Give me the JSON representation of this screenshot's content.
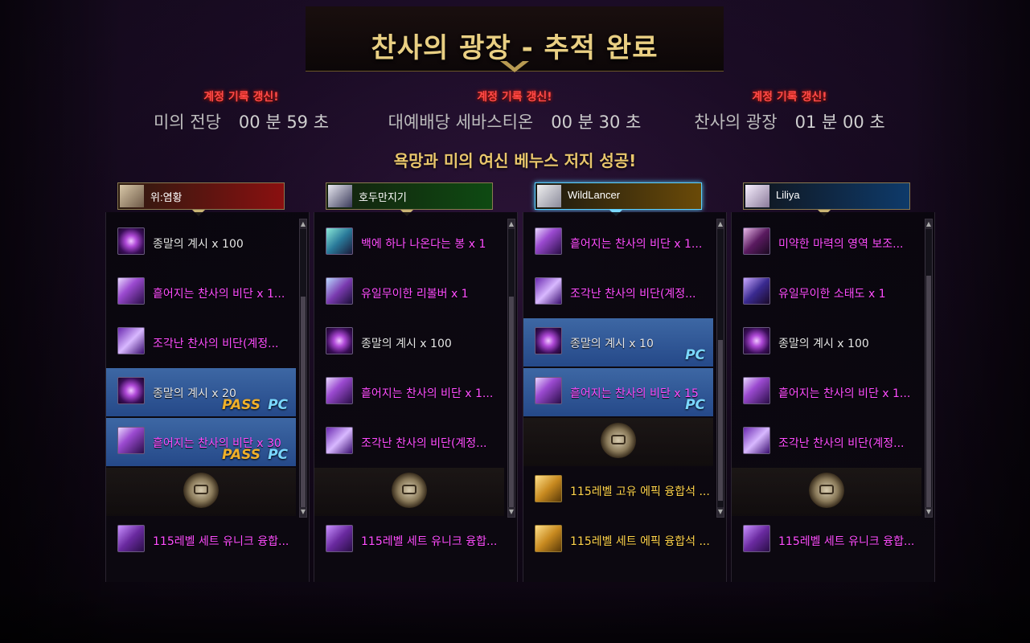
{
  "title": "찬사의 광장 - 추적 완료",
  "records": [
    {
      "badge": "계정 기록 갱신!",
      "dungeon": "미의 전당",
      "time": "00 분 59 초"
    },
    {
      "badge": "계정 기록 갱신!",
      "dungeon": "대예배당 세바스티온",
      "time": "00 분 30 초"
    },
    {
      "badge": "계정 기록 갱신!",
      "dungeon": "찬사의 광장",
      "time": "01 분 00 초"
    }
  ],
  "success_message": "욕망과 미의 여신 베누스 저지 성공!",
  "players": [
    {
      "name": "위:염황",
      "nameplate_color": "#8a1010",
      "items": [
        {
          "icon": "orb",
          "label": "종말의 계시 x 100",
          "color": "white"
        },
        {
          "icon": "wing",
          "label": "흩어지는 찬사의 비단 x 1...",
          "color": "magenta"
        },
        {
          "icon": "shard",
          "label": "조각난 찬사의 비단(계정...",
          "color": "magenta"
        },
        {
          "icon": "orb",
          "label": "종말의 계시 x 20",
          "color": "white",
          "pass": "PASS",
          "pc": "PC",
          "highlight": true
        },
        {
          "icon": "wing",
          "label": "흩어지는 찬사의 비단 x 30",
          "color": "magenta",
          "pass": "PASS",
          "pc": "PC",
          "highlight": true
        }
      ],
      "bonus": {
        "icon": "set",
        "label": "115레벨 세트 유니크 융합...",
        "color": "magenta"
      }
    },
    {
      "name": "호두만지기",
      "nameplate_color": "#0e4a12",
      "items": [
        {
          "icon": "teal",
          "label": "백에 하나 나온다는 봉 x 1",
          "color": "magenta"
        },
        {
          "icon": "rev",
          "label": "유일무이한 리볼버 x 1",
          "color": "magenta"
        },
        {
          "icon": "orb",
          "label": "종말의 계시 x 100",
          "color": "white"
        },
        {
          "icon": "wing",
          "label": "흩어지는 찬사의 비단 x 1...",
          "color": "magenta"
        },
        {
          "icon": "shard",
          "label": "조각난 찬사의 비단(계정...",
          "color": "magenta"
        }
      ],
      "bonus": {
        "icon": "set",
        "label": "115레벨 세트 유니크 융합...",
        "color": "magenta"
      }
    },
    {
      "name": "WildLancer",
      "nameplate_color": "#6a4a08",
      "items": [
        {
          "icon": "wing",
          "label": "흩어지는 찬사의 비단 x 1...",
          "color": "magenta"
        },
        {
          "icon": "shard",
          "label": "조각난 찬사의 비단(계정...",
          "color": "magenta"
        },
        {
          "icon": "orb",
          "label": "종말의 계시 x 10",
          "color": "white",
          "pc": "PC",
          "highlight": true
        },
        {
          "icon": "wing",
          "label": "흩어지는 찬사의 비단 x 15",
          "color": "magenta",
          "pc": "PC",
          "highlight": true
        }
      ],
      "bonus_items": [
        {
          "icon": "gold",
          "label": "115레벨 고유 에픽 융합석 ...",
          "color": "gold"
        },
        {
          "icon": "gold",
          "label": "115레벨 세트 에픽 융합석 ...",
          "color": "gold"
        }
      ]
    },
    {
      "name": "Liliya",
      "nameplate_color": "#0e3a6a",
      "items": [
        {
          "icon": "dark",
          "label": "미약한 마력의 영역 보조...",
          "color": "magenta"
        },
        {
          "icon": "knife",
          "label": "유일무이한 소태도 x 1",
          "color": "magenta"
        },
        {
          "icon": "orb",
          "label": "종말의 계시 x 100",
          "color": "white"
        },
        {
          "icon": "wing",
          "label": "흩어지는 찬사의 비단 x 1...",
          "color": "magenta"
        },
        {
          "icon": "shard",
          "label": "조각난 찬사의 비단(계정...",
          "color": "magenta"
        }
      ],
      "bonus": {
        "icon": "set",
        "label": "115레벨 세트 유니크 융합...",
        "color": "magenta"
      }
    }
  ]
}
